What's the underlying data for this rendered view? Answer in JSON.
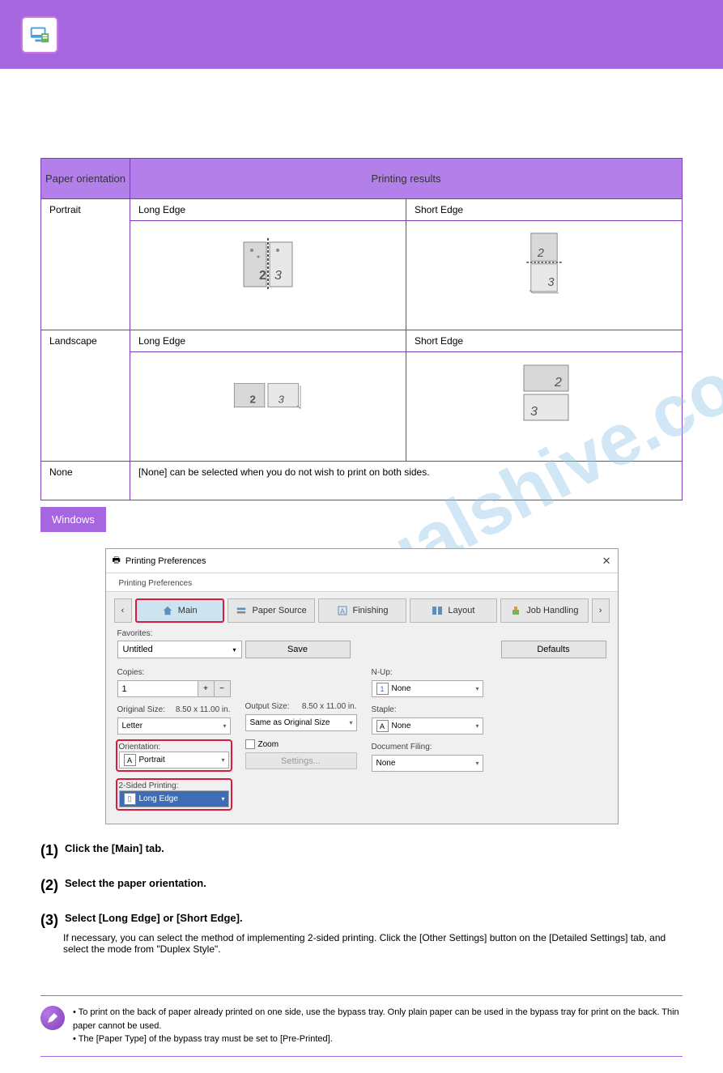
{
  "header": {
    "icon": "printer-monitor-icon"
  },
  "table": {
    "orientation_label": "Paper orientation",
    "results_label": "Printing results",
    "portrait": "Portrait",
    "landscape": "Landscape",
    "long_edge": "Long Edge",
    "short_edge": "Short Edge",
    "none_label": "None",
    "none_desc": "[None] can be selected when you do not wish to print on both sides."
  },
  "button": {
    "windows": "Windows"
  },
  "dialog": {
    "title": "Printing Preferences",
    "tab": "Printing Preferences",
    "nav": {
      "main": "Main",
      "paper": "Paper Source",
      "finishing": "Finishing",
      "layout": "Layout",
      "job": "Job Handling"
    },
    "favorites": {
      "label": "Favorites:",
      "value": "Untitled",
      "save": "Save",
      "defaults": "Defaults"
    },
    "copies": {
      "label": "Copies:",
      "value": "1"
    },
    "original": {
      "label": "Original Size:",
      "dim": "8.50 x 11.00 in.",
      "value": "Letter"
    },
    "orientation": {
      "label": "Orientation:",
      "value": "Portrait"
    },
    "twosided": {
      "label": "2-Sided Printing:",
      "value": "Long Edge"
    },
    "output": {
      "label": "Output Size:",
      "dim": "8.50 x 11.00 in.",
      "value": "Same as Original Size"
    },
    "zoom": {
      "label": "Zoom",
      "settings": "Settings..."
    },
    "nup": {
      "label": "N-Up:",
      "value": "None"
    },
    "staple": {
      "label": "Staple:",
      "value": "None"
    },
    "docfiling": {
      "label": "Document Filing:",
      "value": "None"
    }
  },
  "steps": {
    "s1": {
      "num": "(1)",
      "text": "Click the [Main] tab."
    },
    "s2": {
      "num": "(2)",
      "text": "Select the paper orientation."
    },
    "s3": {
      "num": "(3)",
      "text": "Select [Long Edge] or [Short Edge].",
      "desc": "If necessary, you can select the method of implementing 2-sided printing. Click the [Other Settings] button on the [Detailed Settings] tab, and select the mode from \"Duplex Style\"."
    }
  },
  "note": "• To print on the back of paper already printed on one side, use the bypass tray. Only plain paper can be used in the bypass tray for print on the back. Thin paper cannot be used.\n• The [Paper Type] of the bypass tray must be set to [Pre-Printed]."
}
